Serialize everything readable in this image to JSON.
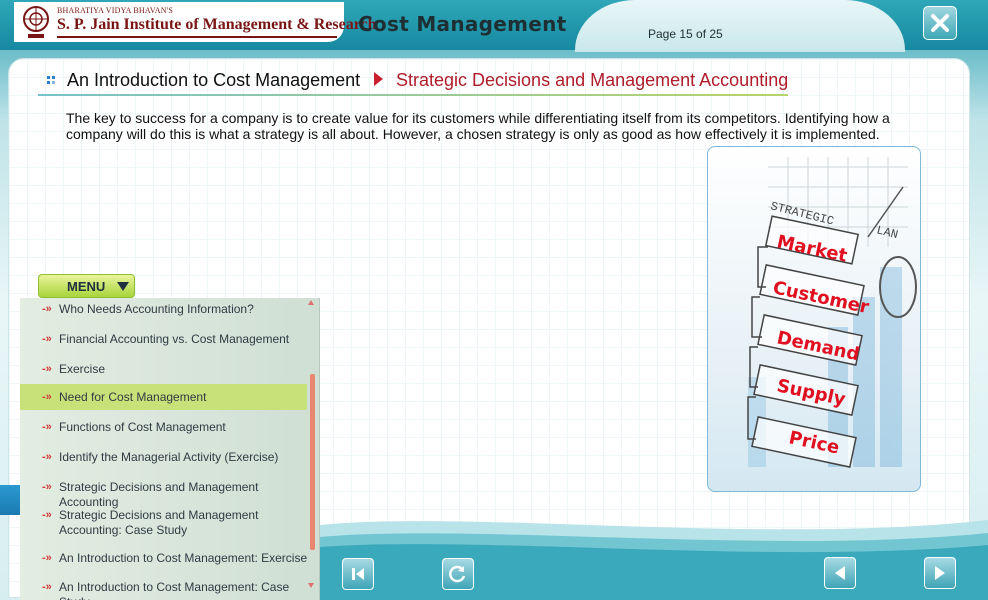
{
  "header": {
    "logo_small": "BHARATIYA VIDYA BHAVAN'S",
    "logo_main": "S. P. Jain Institute of Management & Research",
    "course_title": "Cost Management",
    "page_label": "Page  15 of 25"
  },
  "breadcrumb": {
    "main": "An Introduction to Cost Management",
    "sub": "Strategic Decisions and Management Accounting"
  },
  "content": {
    "paragraph": "The key to success for a company is to create value for its customers while differentiating itself from its competitors. Identifying how a company will do this is what a strategy is all about. However, a chosen strategy is only as good as how effectively it is implemented."
  },
  "illustration": {
    "header_text": "STRATEGIC",
    "header_text_2": "LAN",
    "boxes": [
      "Market",
      "Customer",
      "Demand",
      "Supply",
      "Price"
    ]
  },
  "menu": {
    "button_label": "MENU",
    "items": [
      {
        "label": "Who Needs Accounting Information?",
        "active": false
      },
      {
        "label": "Financial Accounting vs. Cost Management",
        "active": false
      },
      {
        "label": "Exercise",
        "active": false
      },
      {
        "label": "Need for Cost Management",
        "active": true
      },
      {
        "label": "Functions of Cost Management",
        "active": false
      },
      {
        "label": "Identify the Managerial Activity (Exercise)",
        "active": false
      },
      {
        "label": "Strategic Decisions and Management Accounting",
        "active": false
      },
      {
        "label": "Strategic Decisions and Management Accounting: Case Study",
        "active": false
      },
      {
        "label": "An Introduction to Cost Management: Exercise",
        "active": false
      },
      {
        "label": "An Introduction to Cost Management: Case Study",
        "active": false
      }
    ],
    "item_icon": "double-chevron-right-icon"
  },
  "nav": {
    "back_icon": "skip-back-icon",
    "replay_icon": "replay-icon",
    "prev_icon": "prev-arrow-icon",
    "next_icon": "next-arrow-icon",
    "close_icon": "close-icon"
  },
  "colors": {
    "accent_teal": "#1689a0",
    "breadcrumb_red": "#b01c2a",
    "menu_green": "#a8d43c",
    "active_item": "#c8e27a",
    "illustration_red": "#e01020"
  }
}
